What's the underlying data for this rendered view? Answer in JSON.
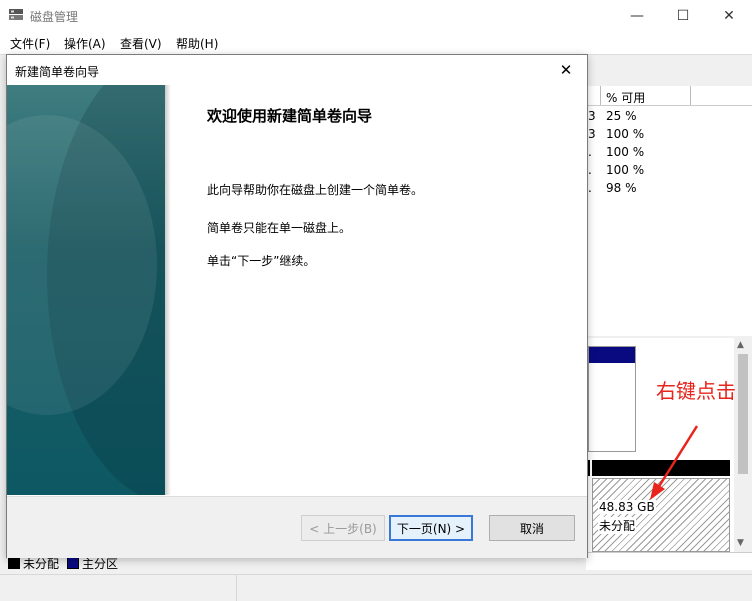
{
  "app": {
    "title": "磁盘管理",
    "icon": "disk-management-icon",
    "minimize_glyph": "—",
    "maximize_glyph": "☐",
    "close_glyph": "✕"
  },
  "menu": [
    "文件(F)",
    "操作(A)",
    "查看(V)",
    "帮助(H)"
  ],
  "volume_list": {
    "header_pct": "% 可用",
    "rows": [
      {
        "trunc": "3",
        "pct": "25 %"
      },
      {
        "trunc": "3",
        "pct": "100 %"
      },
      {
        "trunc": ".",
        "pct": "100 %"
      },
      {
        "trunc": ".",
        "pct": "100 %"
      },
      {
        "trunc": ".",
        "pct": "98 %"
      }
    ]
  },
  "disk_graphic": {
    "unallocated_size": "48.83 GB",
    "unallocated_label": "未分配"
  },
  "legend": [
    {
      "label": "未分配",
      "color": "#000000"
    },
    {
      "label": "主分区",
      "color": "#0a0a80"
    }
  ],
  "wizard": {
    "title": "新建简单卷向导",
    "close_glyph": "✕",
    "heading": "欢迎使用新建简单卷向导",
    "paragraphs": [
      "此向导帮助你在磁盘上创建一个简单卷。",
      "简单卷只能在单一磁盘上。",
      "单击“下一步”继续。"
    ],
    "back_button": "< 上一步(B)",
    "next_button": "下一页(N) >",
    "cancel_button": "取消"
  },
  "annotation": {
    "text": "右键点击",
    "color": "#e8241c"
  }
}
